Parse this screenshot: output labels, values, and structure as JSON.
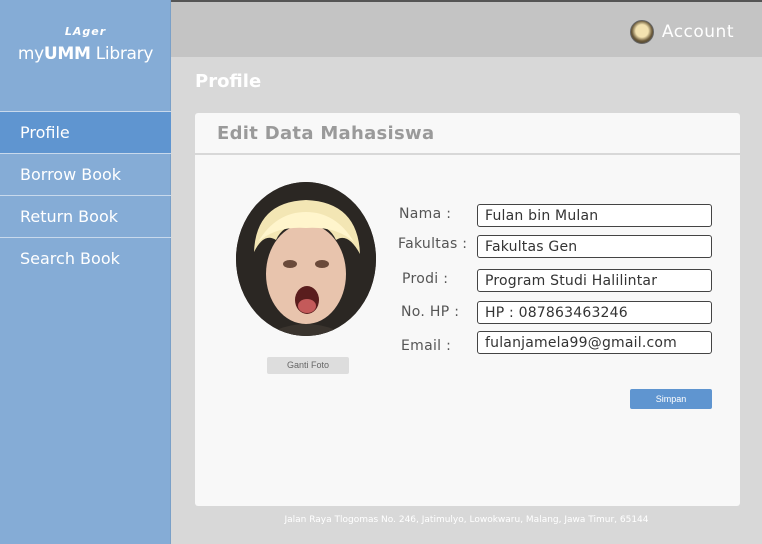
{
  "sidebar": {
    "logo_small": "LAger",
    "logo_main_prefix": "my",
    "logo_main_bold": "UMM",
    "logo_main_suffix": " Library",
    "items": [
      {
        "label": "Profile",
        "active": true
      },
      {
        "label": "Borrow Book",
        "active": false
      },
      {
        "label": "Return Book",
        "active": false
      },
      {
        "label": "Search Book",
        "active": false
      }
    ]
  },
  "header": {
    "account_label": "Account"
  },
  "page": {
    "title": "Profile"
  },
  "card": {
    "title": "Edit Data Mahasiswa",
    "change_photo_label": "Ganti Foto",
    "fields": [
      {
        "label": "Nama :",
        "value": "Fulan bin Mulan"
      },
      {
        "label": "Fakultas :",
        "value": "Fakultas Gen"
      },
      {
        "label": "Prodi :",
        "value": "Program Studi Halilintar"
      },
      {
        "label": "No. HP :",
        "value": "HP : 087863463246"
      },
      {
        "label": "Email :",
        "value": "fulanjamela99@gmail.com"
      }
    ],
    "save_label": "Simpan"
  },
  "footer": {
    "address": "Jalan Raya Tlogomas No. 246, Jatimulyo, Lowokwaru, Malang, Jawa Timur, 65144"
  },
  "colors": {
    "sidebar": "#85acd6",
    "sidebar_active": "#5f95d0",
    "topbar": "#c4c4c4",
    "background": "#d8d8d8",
    "card": "#f8f8f8",
    "button": "#5f95d0"
  }
}
